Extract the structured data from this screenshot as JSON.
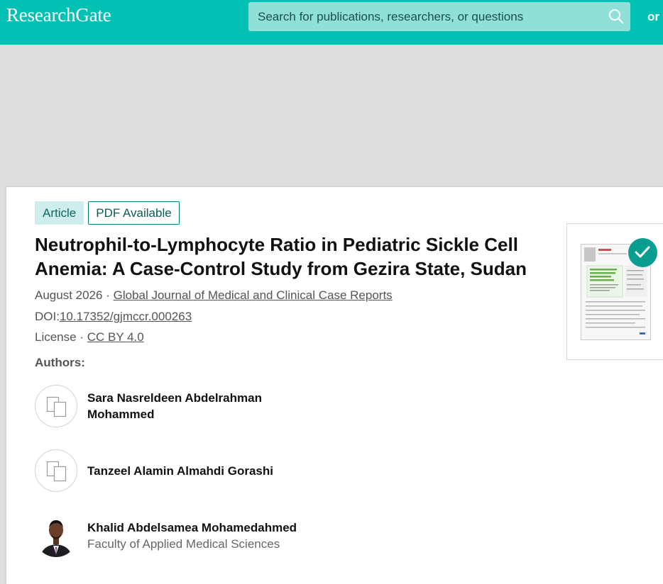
{
  "header": {
    "logo": "ResearchGate",
    "search_placeholder": "Search for publications, researchers, or questions",
    "or_text": "or"
  },
  "article": {
    "badges": [
      "Article",
      "PDF Available"
    ],
    "title": "Neutrophil-to-Lymphocyte Ratio in Pediatric Sickle Cell Anemia: A Case-Control Study from Gezira State, Sudan",
    "date": "August 2026",
    "journal": "Global Journal of Medical and Clinical Case Reports",
    "doi_label": "DOI:",
    "doi": "10.17352/gjmccr.000263",
    "license_label": "License",
    "license": "CC BY 4.0",
    "authors_label": "Authors:",
    "authors": [
      {
        "name": "Sara Nasreldeen Abdelrahman Mohammed",
        "affiliation": "",
        "avatar": "placeholder-icon"
      },
      {
        "name": "Tanzeel Alamin Almahdi Gorashi",
        "affiliation": "",
        "avatar": "placeholder-icon"
      },
      {
        "name": "Khalid Abdelsamea Mohamedahmed",
        "affiliation": "Faculty of Applied Medical Sciences",
        "avatar": "photo"
      }
    ]
  },
  "thumbnail": {
    "icon": "checkmark-icon"
  },
  "colors": {
    "brand": "#00c1b3",
    "check": "#0a9d92"
  }
}
